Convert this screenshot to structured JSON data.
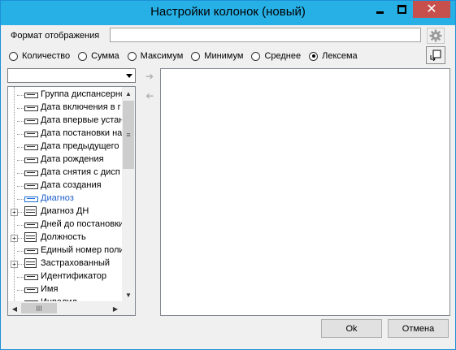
{
  "window": {
    "title": "Настройки колонок (новый)",
    "accent_color": "#27b0e6",
    "close_color": "#c7504d"
  },
  "format": {
    "label": "Формат отображения",
    "value": "",
    "gear_icon": "gear-icon"
  },
  "aggregations": {
    "options": [
      "Количество",
      "Сумма",
      "Максимум",
      "Минимум",
      "Среднее",
      "Лексема"
    ],
    "selected": "Лексема"
  },
  "field_combo": {
    "value": ""
  },
  "tree": {
    "items": [
      {
        "label": "Группа диспансерного",
        "icon": "field-icon",
        "expandable": false
      },
      {
        "label": "Дата включения в г",
        "icon": "field-icon",
        "expandable": false
      },
      {
        "label": "Дата впервые устан",
        "icon": "field-icon",
        "expandable": false
      },
      {
        "label": "Дата постановки на",
        "icon": "field-icon",
        "expandable": false
      },
      {
        "label": "Дата предыдущего",
        "icon": "field-icon",
        "expandable": false
      },
      {
        "label": "Дата рождения",
        "icon": "field-icon",
        "expandable": false
      },
      {
        "label": "Дата снятия с дисп",
        "icon": "field-icon",
        "expandable": false
      },
      {
        "label": "Дата создания",
        "icon": "field-icon",
        "expandable": false
      },
      {
        "label": "Диагноз",
        "icon": "field-icon",
        "expandable": false,
        "selected": true
      },
      {
        "label": "Диагноз ДН",
        "icon": "table-icon",
        "expandable": true
      },
      {
        "label": "Дней до постановки",
        "icon": "field-icon",
        "expandable": false
      },
      {
        "label": "Должность",
        "icon": "table-icon",
        "expandable": true
      },
      {
        "label": "Единый номер поли",
        "icon": "field-icon",
        "expandable": false
      },
      {
        "label": "Застрахованный",
        "icon": "table-icon",
        "expandable": true
      },
      {
        "label": "Идентификатор",
        "icon": "field-icon",
        "expandable": false
      },
      {
        "label": "Имя",
        "icon": "field-icon",
        "expandable": false
      },
      {
        "label": "Инвалид",
        "icon": "field-icon",
        "expandable": false
      }
    ],
    "selected_color": "#1e5fc8"
  },
  "buttons": {
    "ok": "Ok",
    "cancel": "Отмена"
  }
}
